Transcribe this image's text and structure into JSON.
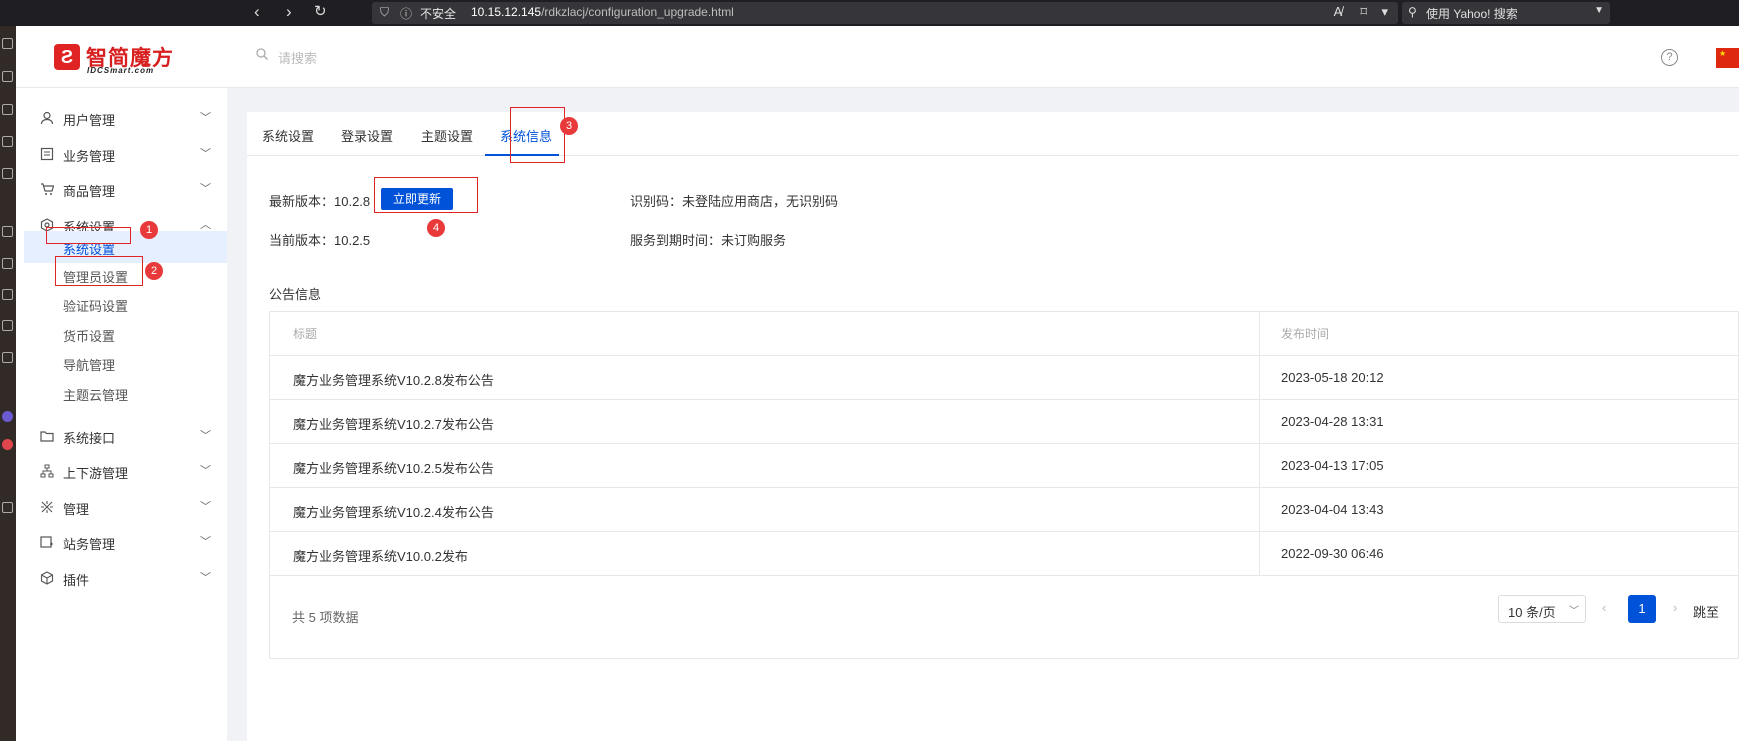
{
  "browser": {
    "security_label": "不安全",
    "url_host": "10.15.12.145",
    "url_path": "/rdkzlacj/configuration_upgrade.html",
    "search_placeholder": "使用 Yahoo! 搜索"
  },
  "header": {
    "logo_text": "智简魔方",
    "logo_sub": "IDCSmart.com",
    "search_placeholder": "请搜索",
    "help_glyph": "?"
  },
  "sidebar": {
    "items": [
      {
        "label": "用户管理",
        "icon": "user-icon"
      },
      {
        "label": "业务管理",
        "icon": "document-icon"
      },
      {
        "label": "商品管理",
        "icon": "cart-icon"
      },
      {
        "label": "系统设置",
        "icon": "hexagon-settings-icon"
      },
      {
        "label": "系统接口",
        "icon": "folder-icon"
      },
      {
        "label": "上下游管理",
        "icon": "network-icon"
      },
      {
        "label": "管理",
        "icon": "cross-icon"
      },
      {
        "label": "站务管理",
        "icon": "site-icon"
      },
      {
        "label": "插件",
        "icon": "cube-icon"
      }
    ],
    "sub_items": [
      {
        "label": "系统设置"
      },
      {
        "label": "管理员设置"
      },
      {
        "label": "验证码设置"
      },
      {
        "label": "货币设置"
      },
      {
        "label": "导航管理"
      },
      {
        "label": "主题云管理"
      }
    ]
  },
  "tabs": [
    "系统设置",
    "登录设置",
    "主题设置",
    "系统信息"
  ],
  "info": {
    "latest_label": "最新版本：10.2.8",
    "update_button": "立即更新",
    "current_label": "当前版本：10.2.5",
    "id_code_label": "识别码：未登陆应用商店，无识别码",
    "expire_label": "服务到期时间：未订购服务"
  },
  "announcements": {
    "title": "公告信息",
    "columns": [
      "标题",
      "发布时间"
    ],
    "rows": [
      {
        "title": "魔方业务管理系统V10.2.8发布公告",
        "time": "2023-05-18 20:12"
      },
      {
        "title": "魔方业务管理系统V10.2.7发布公告",
        "time": "2023-04-28 13:31"
      },
      {
        "title": "魔方业务管理系统V10.2.5发布公告",
        "time": "2023-04-13 17:05"
      },
      {
        "title": "魔方业务管理系统V10.2.4发布公告",
        "time": "2023-04-04 13:43"
      },
      {
        "title": "魔方业务管理系统V10.0.2发布",
        "time": "2022-09-30 06:46"
      }
    ],
    "total": "共 5 项数据",
    "page_size": "10 条/页",
    "current_page": "1",
    "jump_label": "跳至"
  },
  "annotations": [
    "1",
    "2",
    "3",
    "4"
  ],
  "colors": {
    "accent": "#0052d9",
    "annotation": "#e02424"
  }
}
